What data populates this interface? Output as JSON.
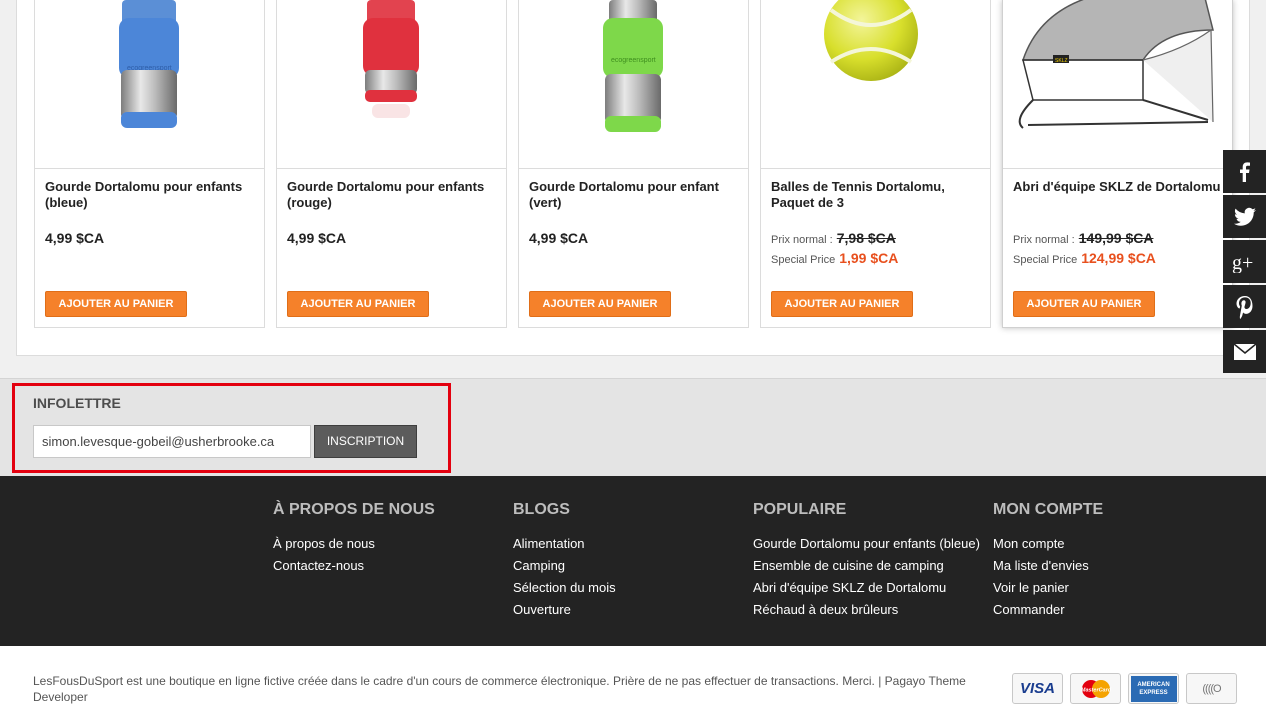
{
  "products": [
    {
      "name": "Gourde Dortalomu pour enfants (bleue)",
      "price": "4,99 $CA",
      "button": "AJOUTER AU PANIER",
      "image_label": "ecogreensport"
    },
    {
      "name": "Gourde Dortalomu pour enfants (rouge)",
      "price": "4,99 $CA",
      "button": "AJOUTER AU PANIER"
    },
    {
      "name": "Gourde Dortalomu pour enfant (vert)",
      "price": "4,99 $CA",
      "button": "AJOUTER AU PANIER",
      "image_label": "ecogreensport"
    },
    {
      "name": "Balles de Tennis Dortalomu, Paquet de 3",
      "normal_label": "Prix normal :",
      "normal_price": "7,98 $CA",
      "special_label": "Special Price",
      "special_price": "1,99 $CA",
      "button": "AJOUTER AU PANIER"
    },
    {
      "name": "Abri d'équipe SKLZ de Dortalomu",
      "normal_label": "Prix normal :",
      "normal_price": "149,99 $CA",
      "special_label": "Special Price",
      "special_price": "124,99 $CA",
      "button": "AJOUTER AU PANIER",
      "image_label": "SKLZ"
    }
  ],
  "social": [
    {
      "icon": "facebook-icon"
    },
    {
      "icon": "twitter-icon"
    },
    {
      "icon": "google-plus-icon"
    },
    {
      "icon": "pinterest-icon"
    },
    {
      "icon": "email-icon"
    }
  ],
  "newsletter": {
    "title": "INFOLETTRE",
    "email_value": "simon.levesque-gobeil@usherbrooke.ca",
    "button": "INSCRIPTION"
  },
  "footer": {
    "columns": [
      {
        "title": "À PROPOS DE NOUS",
        "links": [
          "À propos de nous",
          "Contactez-nous"
        ]
      },
      {
        "title": "BLOGS",
        "links": [
          "Alimentation",
          "Camping",
          "Sélection du mois",
          "Ouverture"
        ]
      },
      {
        "title": "POPULAIRE",
        "links": [
          "Gourde Dortalomu pour enfants (bleue)",
          "Ensemble de cuisine de camping",
          "Abri d'équipe SKLZ de Dortalomu",
          "Réchaud à deux brûleurs"
        ]
      },
      {
        "title": "MON COMPTE",
        "links": [
          "Mon compte",
          "Ma liste d'envies",
          "Voir le panier",
          "Commander"
        ]
      }
    ]
  },
  "bottom": {
    "copyright": "LesFousDuSport est une boutique en ligne fictive créée dans le cadre d'un cours de commerce électronique. Prière de ne pas effectuer de transactions. Merci. | Pagayo Theme Developer",
    "payments": [
      {
        "icon": "visa-icon",
        "label": "VISA"
      },
      {
        "icon": "mastercard-icon",
        "label": "MasterCard"
      },
      {
        "icon": "amex-icon",
        "label": "AMERICAN EXPRESS"
      },
      {
        "icon": "contactless-icon",
        "label": "((((O"
      }
    ]
  },
  "colors": {
    "accent_orange": "#f5812a",
    "special_price": "#e8501e",
    "highlight_red": "#e3000f",
    "footer_bg": "#232323"
  }
}
